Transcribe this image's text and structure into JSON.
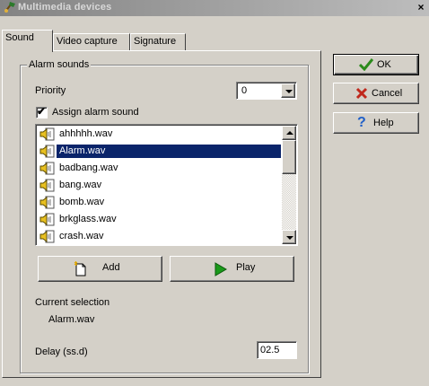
{
  "window": {
    "title": "Multimedia devices",
    "close_glyph": "×"
  },
  "tabs": [
    {
      "label": "Sound",
      "active": true
    },
    {
      "label": "Video capture",
      "active": false
    },
    {
      "label": "Signature",
      "active": false
    }
  ],
  "alarm_group": {
    "label": "Alarm sounds",
    "priority_label": "Priority",
    "priority_value": "0",
    "assign_label": "Assign alarm sound",
    "assign_checked": true,
    "check_glyph": "✔",
    "sound_files": [
      "ahhhhh.wav",
      "Alarm.wav",
      "badbang.wav",
      "bang.wav",
      "bomb.wav",
      "brkglass.wav",
      "crash.wav"
    ],
    "selected_index": 1,
    "item_icon": "speaker-file-icon",
    "add_label": "Add",
    "play_label": "Play",
    "current_selection_label": "Current selection",
    "current_selection_value": "Alarm.wav",
    "delay_label": "Delay (ss.d)",
    "delay_value": "02.5"
  },
  "dialog_buttons": {
    "ok_label": "OK",
    "cancel_label": "Cancel",
    "help_label": "Help"
  },
  "colors": {
    "selection": "#0a246a",
    "ok_check": "#2a8a1a",
    "cancel_x": "#c0281c",
    "help_q": "#1f5fc8",
    "play_triangle": "#1a9a1a"
  }
}
